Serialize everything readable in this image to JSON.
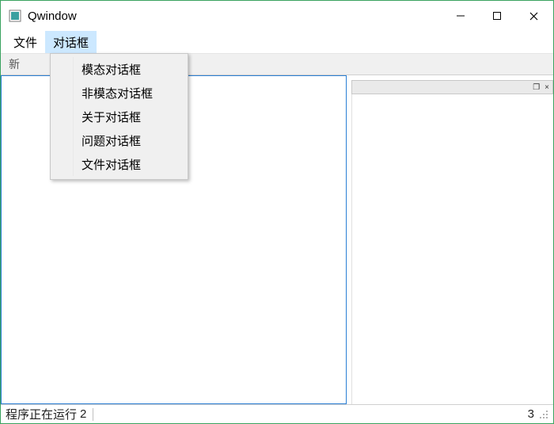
{
  "window": {
    "title": "Qwindow"
  },
  "menubar": {
    "items": [
      {
        "label": "文件"
      },
      {
        "label": "对话框"
      }
    ],
    "open_index": 1
  },
  "dropdown": {
    "items": [
      {
        "label": "模态对话框"
      },
      {
        "label": "非模态对话框"
      },
      {
        "label": "关于对话框"
      },
      {
        "label": "问题对话框"
      },
      {
        "label": "文件对话框"
      }
    ]
  },
  "toolbar": {
    "visible_text": "新"
  },
  "dock": {
    "float_icon": "❐",
    "close_icon": "×"
  },
  "statusbar": {
    "message": "程序正在运行",
    "left_number": "2",
    "right_number": "3"
  }
}
